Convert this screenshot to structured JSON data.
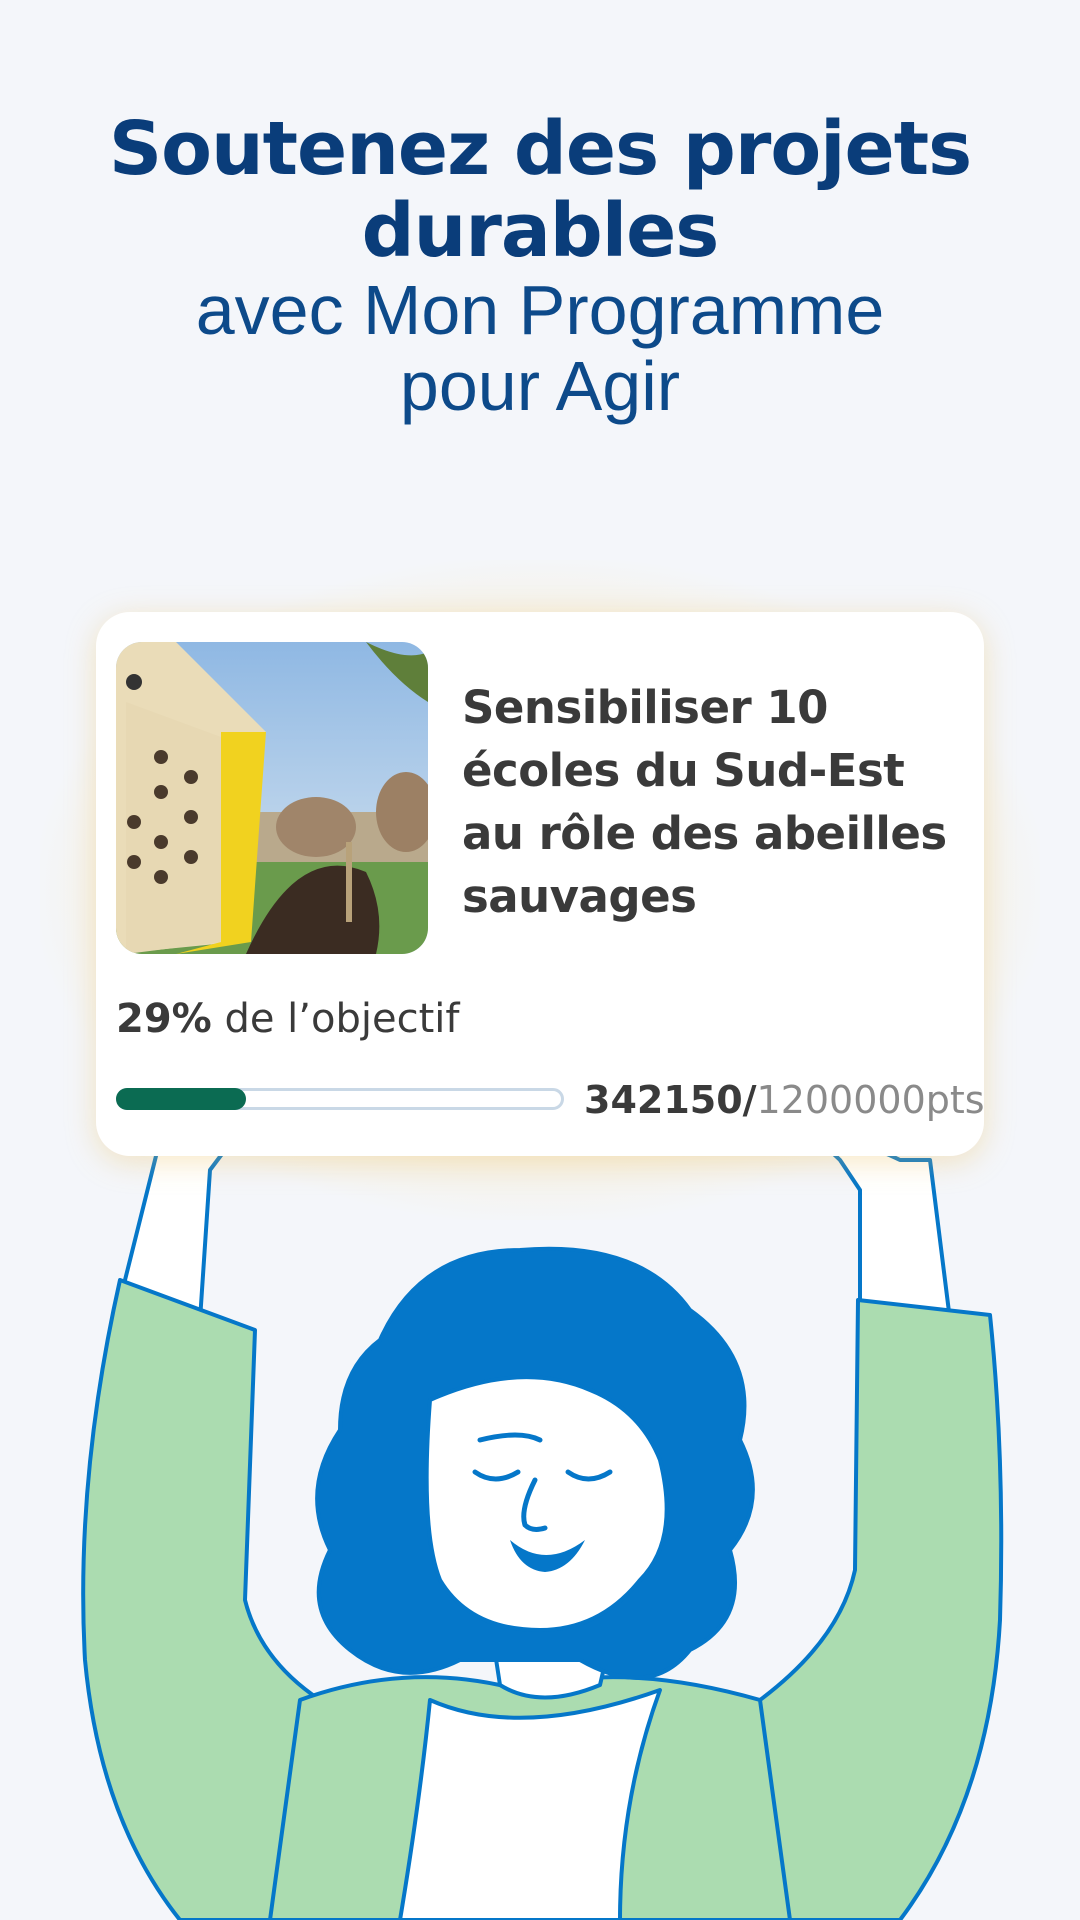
{
  "headline": {
    "line1": "Soutenez des projets",
    "line2": "durables",
    "line3": "avec Mon Programme",
    "line4": "pour Agir"
  },
  "card": {
    "title": "Sensibiliser 10 écoles du Sud-Est au rôle des abeilles sauvages",
    "percent": "29%",
    "objective_suffix": " de l’objectif",
    "progress_fraction": 0.29,
    "points_current": "342150/",
    "points_total": "1200000pts"
  },
  "colors": {
    "headline": "#0a3d7a",
    "progress_fill": "#0b6b52",
    "hair": "#0577c9",
    "sweater": "#abdcb0",
    "glow": "#ffd678"
  }
}
